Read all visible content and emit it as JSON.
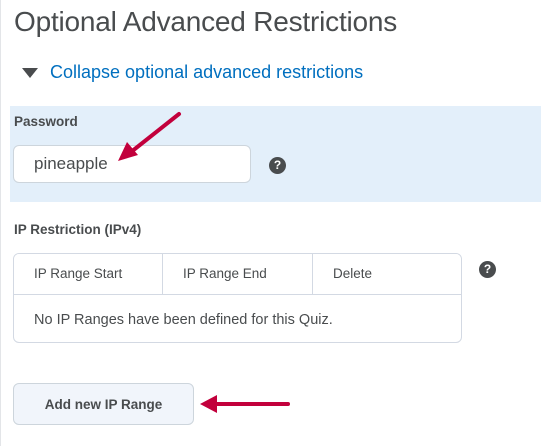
{
  "section": {
    "title": "Optional Advanced Restrictions",
    "collapse_link": "Collapse optional advanced restrictions"
  },
  "password": {
    "label": "Password",
    "value": "pineapple"
  },
  "ip_restriction": {
    "label": "IP Restriction (IPv4)",
    "columns": [
      "IP Range Start",
      "IP Range End",
      "Delete"
    ],
    "empty_message": "No IP Ranges have been defined for this Quiz.",
    "add_button": "Add new IP Range"
  },
  "icons": {
    "help": "help-icon",
    "collapse": "triangle-down-icon",
    "annotation": "arrow-icon"
  },
  "colors": {
    "link": "#006fbf",
    "panel_highlight": "#e3effa",
    "annotation_arrow": "#c2003c"
  }
}
